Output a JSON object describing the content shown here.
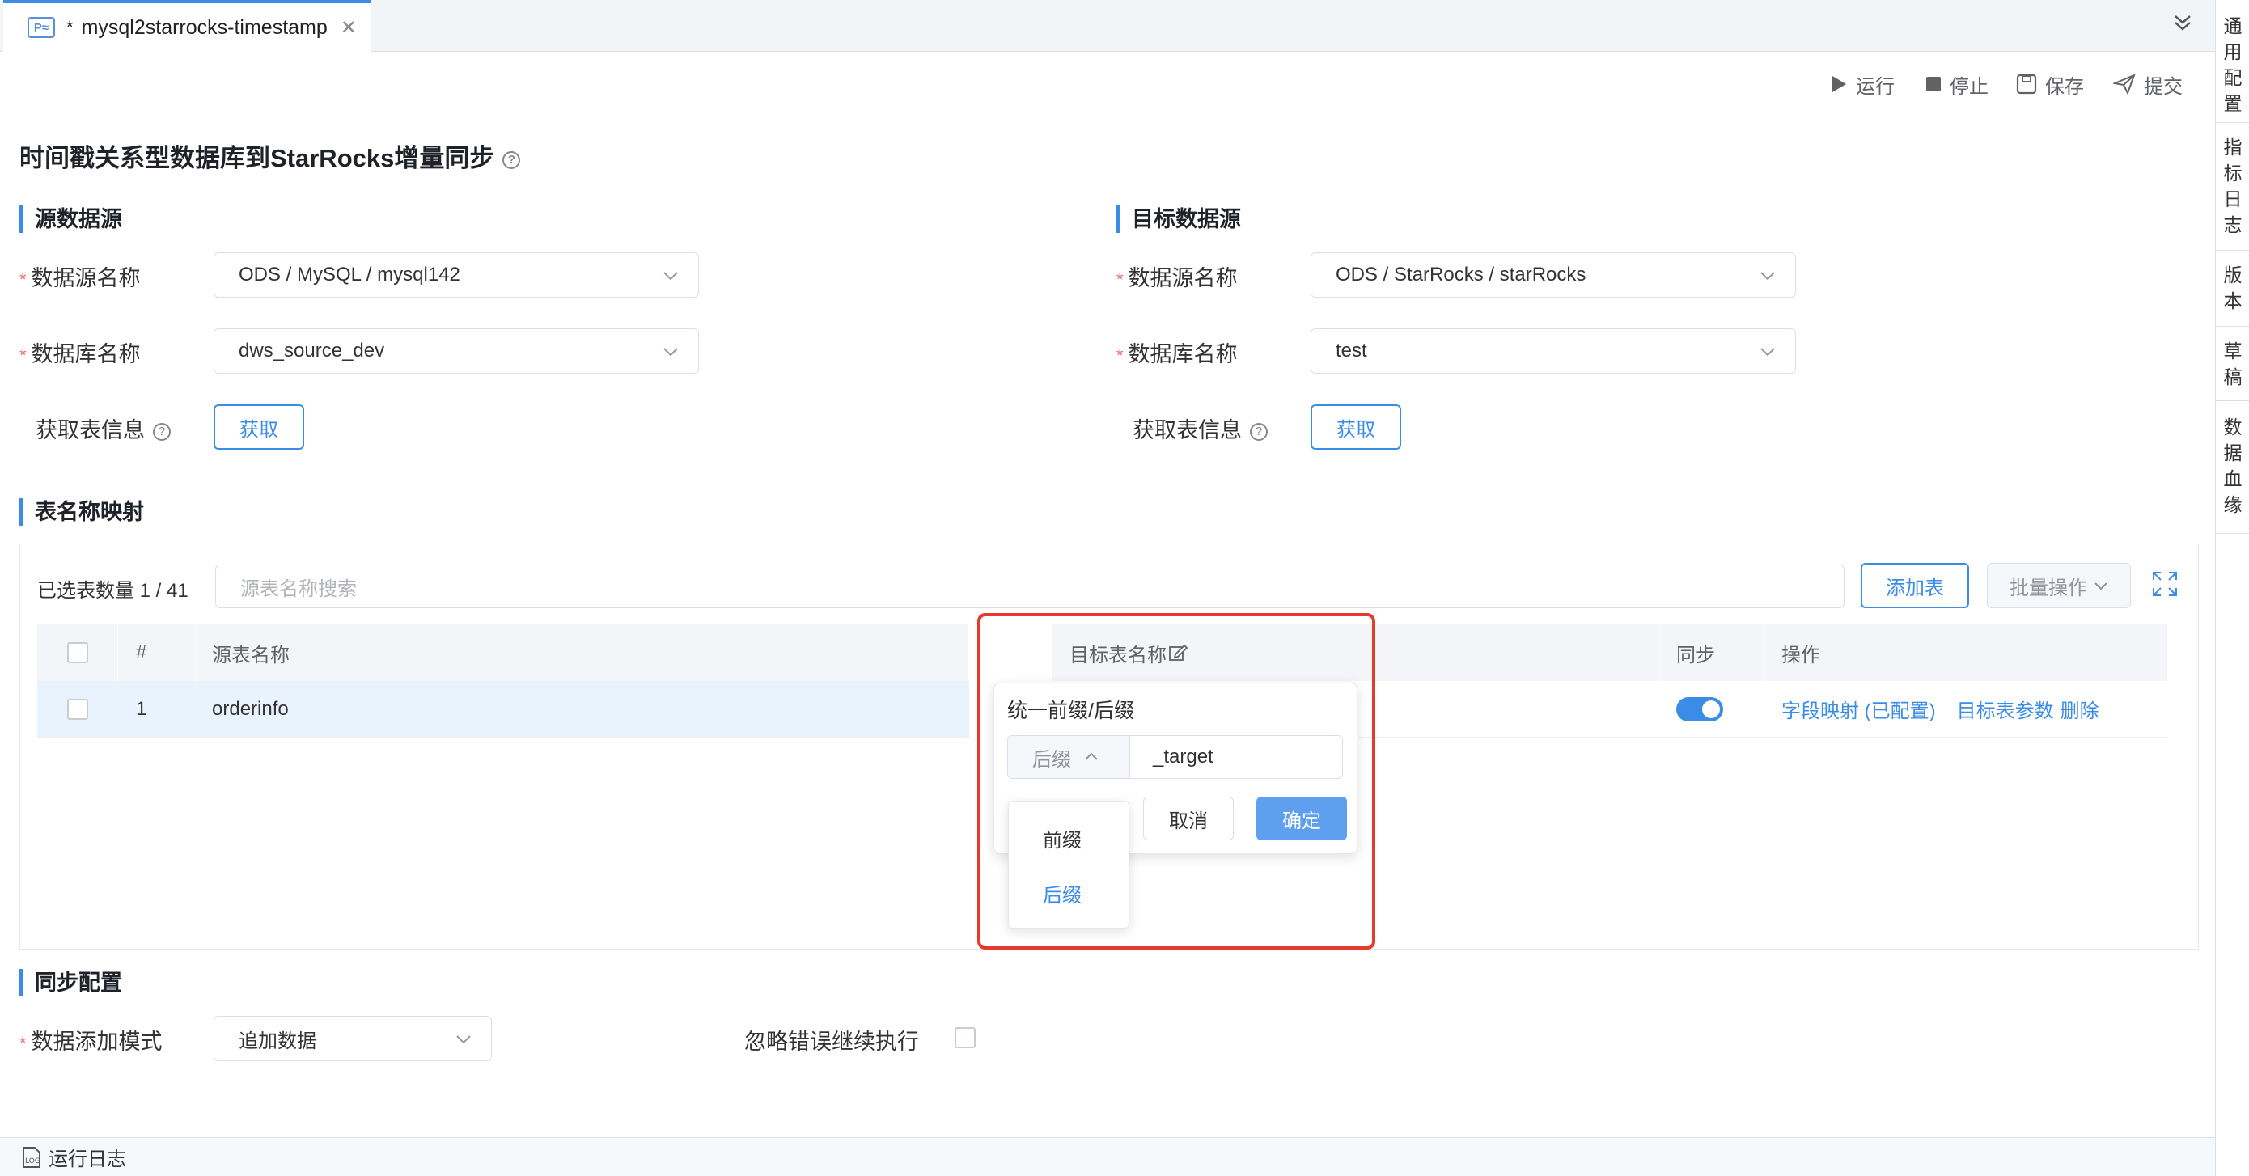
{
  "tab": {
    "badge": "P≈",
    "modified": "*",
    "title": "mysql2starrocks-timestamp",
    "close": "✕"
  },
  "toolbar": {
    "run": "运行",
    "stop": "停止",
    "save": "保存",
    "submit": "提交"
  },
  "right_sidebar": [
    "通用配置",
    "指标日志",
    "版本",
    "草稿",
    "数据血缘"
  ],
  "page": {
    "title": "时间戳关系型数据库到StarRocks增量同步"
  },
  "source": {
    "title": "源数据源",
    "ds_label": "数据源名称",
    "ds_value": "ODS / MySQL / mysql142",
    "db_label": "数据库名称",
    "db_value": "dws_source_dev",
    "fetch_label": "获取表信息",
    "fetch_button": "获取"
  },
  "target": {
    "title": "目标数据源",
    "ds_label": "数据源名称",
    "ds_value": "ODS / StarRocks / starRocks",
    "db_label": "数据库名称",
    "db_value": "test",
    "fetch_label": "获取表信息",
    "fetch_button": "获取"
  },
  "mapping": {
    "title": "表名称映射",
    "selected_count": "已选表数量 1 / 41",
    "search_placeholder": "源表名称搜索",
    "add_table": "添加表",
    "batch": "批量操作",
    "columns": {
      "index": "#",
      "source": "源表名称",
      "target": "目标表名称",
      "sync": "同步",
      "action": "操作"
    },
    "rows": [
      {
        "index": "1",
        "source": "orderinfo",
        "sync": true,
        "actions": [
          "字段映射 (已配置)",
          "目标表参数",
          "删除"
        ]
      }
    ]
  },
  "popover": {
    "title": "统一前缀/后缀",
    "mode": "后缀",
    "value": "_target",
    "cancel": "取消",
    "confirm": "确定",
    "options": [
      "前缀",
      "后缀"
    ],
    "selected_option": "后缀"
  },
  "sync_config": {
    "title": "同步配置",
    "mode_label": "数据添加模式",
    "mode_value": "追加数据",
    "ignore_label": "忽略错误继续执行"
  },
  "bottom": {
    "log": "运行日志"
  },
  "colors": {
    "accent": "#3b8ce6",
    "highlight_box": "#e53a2e",
    "required": "#f56c6c"
  }
}
